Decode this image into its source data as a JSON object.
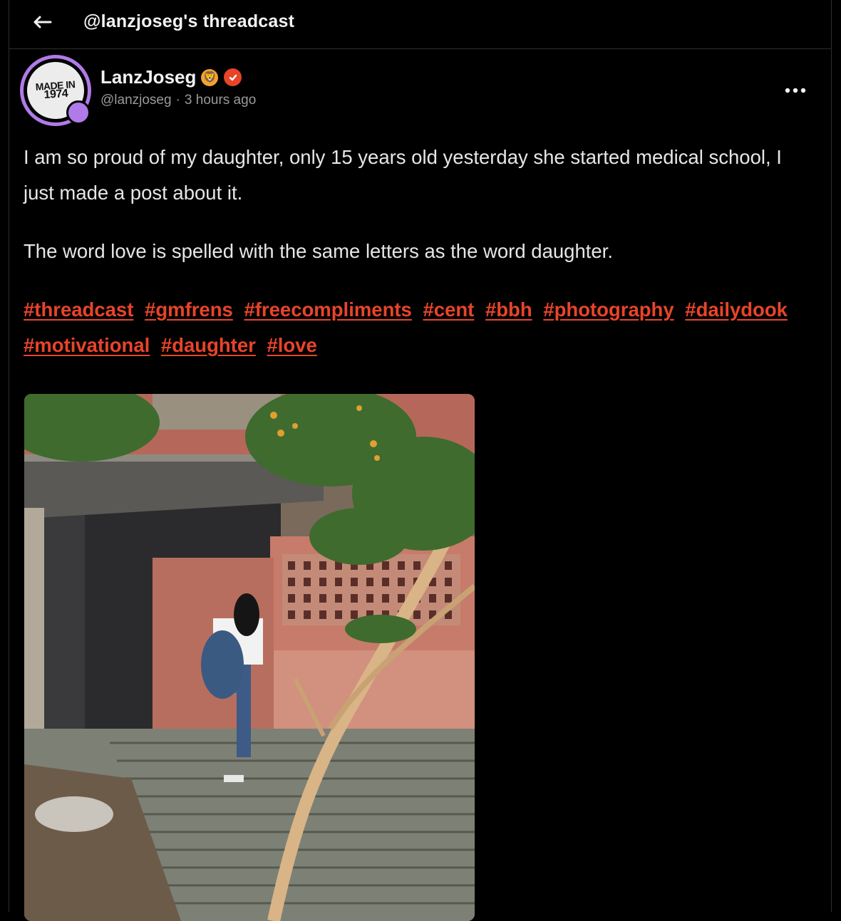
{
  "header": {
    "title": "@lanzjoseg's threadcast"
  },
  "author": {
    "display_name": "LanzJoseg",
    "badge_emoji": "🦁",
    "handle": "@lanzjoseg",
    "separator": "·",
    "timestamp": "3 hours ago",
    "avatar_text_line1": "MADE IN",
    "avatar_text_line2": "1974"
  },
  "post": {
    "paragraphs": [
      "I am so proud of my daughter, only 15 years old yesterday she started medical school, I just made a post about it.",
      "The word love is spelled with the same letters as the word daughter."
    ],
    "hashtags": [
      "#threadcast",
      "#gmfrens",
      "#freecompliments",
      "#cent",
      "#bbh",
      "#photography",
      "#dailydook",
      "#motivational",
      "#daughter",
      "#love"
    ]
  },
  "colors": {
    "background": "#000000",
    "accent": "#e8442a",
    "avatar_ring": "#b07be8",
    "muted_text": "#9a9a9a"
  },
  "icons": {
    "back": "arrow-left-icon",
    "verified": "verified-check-icon",
    "more": "more-horizontal-icon"
  }
}
